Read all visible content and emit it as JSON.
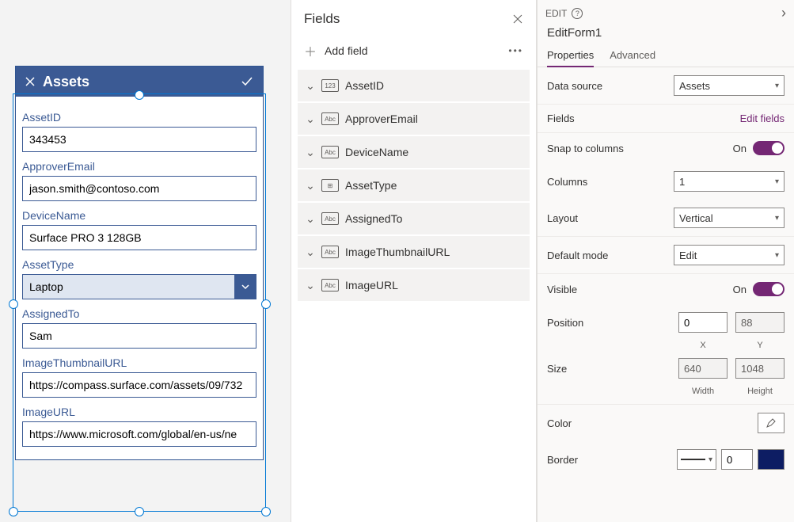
{
  "form": {
    "title": "Assets",
    "fields": {
      "assetId": {
        "label": "AssetID",
        "value": "343453"
      },
      "approverEmail": {
        "label": "ApproverEmail",
        "value": "jason.smith@contoso.com"
      },
      "deviceName": {
        "label": "DeviceName",
        "value": "Surface PRO 3 128GB"
      },
      "assetType": {
        "label": "AssetType",
        "value": "Laptop"
      },
      "assignedTo": {
        "label": "AssignedTo",
        "value": "Sam"
      },
      "thumbUrl": {
        "label": "ImageThumbnailURL",
        "value": "https://compass.surface.com/assets/09/732"
      },
      "imageUrl": {
        "label": "ImageURL",
        "value": "https://www.microsoft.com/global/en-us/ne"
      }
    }
  },
  "fieldsPanel": {
    "title": "Fields",
    "addLabel": "Add field",
    "items": [
      {
        "name": "AssetID",
        "typeIcon": "123"
      },
      {
        "name": "ApproverEmail",
        "typeIcon": "Abc"
      },
      {
        "name": "DeviceName",
        "typeIcon": "Abc"
      },
      {
        "name": "AssetType",
        "typeIcon": "⊞"
      },
      {
        "name": "AssignedTo",
        "typeIcon": "Abc"
      },
      {
        "name": "ImageThumbnailURL",
        "typeIcon": "Abc"
      },
      {
        "name": "ImageURL",
        "typeIcon": "Abc"
      }
    ]
  },
  "propPanel": {
    "editLabel": "EDIT",
    "formName": "EditForm1",
    "tabs": {
      "properties": "Properties",
      "advanced": "Advanced"
    },
    "dataSource": {
      "label": "Data source",
      "value": "Assets"
    },
    "fields": {
      "label": "Fields",
      "link": "Edit fields"
    },
    "snap": {
      "label": "Snap to columns",
      "value": "On"
    },
    "columns": {
      "label": "Columns",
      "value": "1"
    },
    "layout": {
      "label": "Layout",
      "value": "Vertical"
    },
    "defaultMode": {
      "label": "Default mode",
      "value": "Edit"
    },
    "visible": {
      "label": "Visible",
      "value": "On"
    },
    "position": {
      "label": "Position",
      "x": "0",
      "y": "88",
      "xLabel": "X",
      "yLabel": "Y"
    },
    "size": {
      "label": "Size",
      "w": "640",
      "h": "1048",
      "wLabel": "Width",
      "hLabel": "Height"
    },
    "color": {
      "label": "Color"
    },
    "border": {
      "label": "Border",
      "width": "0"
    }
  }
}
